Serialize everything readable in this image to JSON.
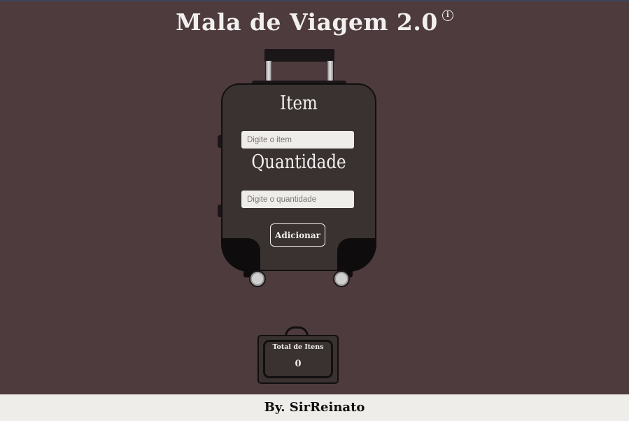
{
  "header": {
    "title": "Mala de Viagem 2.0",
    "info_icon": "info-circle-icon"
  },
  "form": {
    "item_label": "Item",
    "item_placeholder": "Digite o item",
    "item_value": "",
    "quantity_label": "Quantidade",
    "quantity_placeholder": "Digite o quantidade",
    "quantity_value": "",
    "add_button": "Adicionar"
  },
  "total": {
    "label": "Total de Itens",
    "value": "0"
  },
  "footer": {
    "credit": "By. SirReinato"
  },
  "colors": {
    "background": "#4e3b3e",
    "suitcase_body": "#3a3230",
    "suitcase_dark": "#120f10",
    "text_light": "#f2f0ef",
    "footer_bg": "#efedea"
  }
}
